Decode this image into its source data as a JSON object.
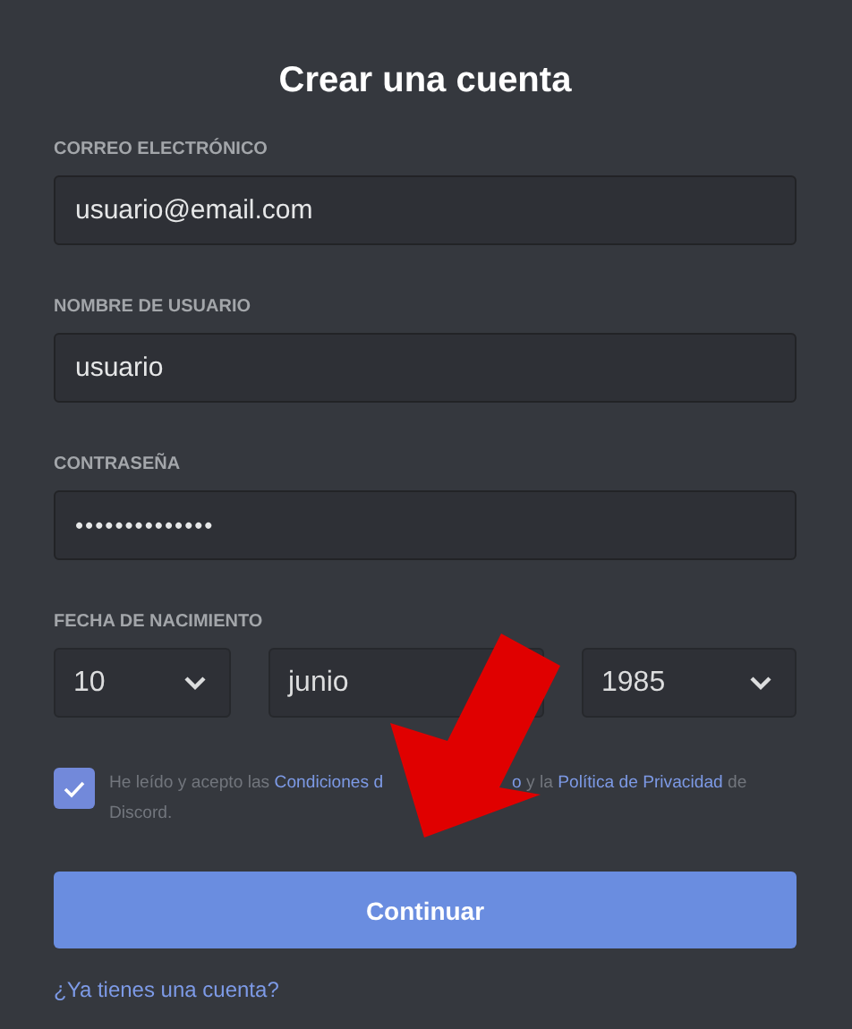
{
  "title": "Crear una cuenta",
  "fields": [
    {
      "label": "CORREO ELECTRÓNICO",
      "value": "usuario@email.com",
      "kind": "text"
    },
    {
      "label": "NOMBRE DE USUARIO",
      "value": "usuario",
      "kind": "text"
    },
    {
      "label": "CONTRASEÑA",
      "value": "••••••••••••••",
      "kind": "password"
    }
  ],
  "birth_date": {
    "label": "FECHA DE NACIMIENTO",
    "selects": [
      {
        "value": "10",
        "chevron_visible": true
      },
      {
        "value": "junio"
      },
      {
        "value": "1985",
        "chevron_visible": true
      }
    ]
  },
  "agreement": {
    "checked": true,
    "text_before": "He leído y acepto las",
    "terms_link": "Condiciones d",
    "terms_link_tail": "o",
    "text_middle": "y la",
    "privacy_link": "Política de Privacidad",
    "text_after": "de Discord."
  },
  "submit_button": "Continuar",
  "login_link": "¿Ya tienes una cuenta?"
}
